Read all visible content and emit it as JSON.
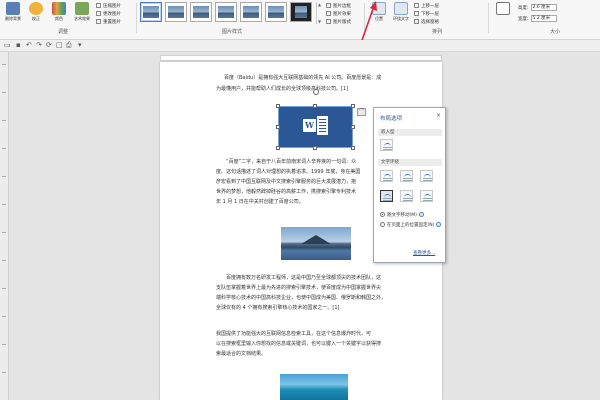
{
  "ribbon": {
    "tools": [
      {
        "label": "删除背景",
        "color": "#5b7fb4"
      },
      {
        "label": "校正",
        "color": "#f0b23b"
      },
      {
        "label": "颜色",
        "color": "#c84f4f"
      },
      {
        "label": "艺术效果",
        "color": "#7aa75a"
      }
    ],
    "small_commands": [
      "压缩图片",
      "更改图片",
      "重置图片"
    ],
    "adjust_group_label": "调整",
    "styles_group_label": "图片样式",
    "picture_commands": [
      "图片边框",
      "图片效果",
      "图片版式"
    ],
    "arrange_commands": [
      "位置",
      "环绕文字",
      "上移一层",
      "下移一层",
      "选择窗格"
    ],
    "arrange_group_label": "排列",
    "size_group_label": "大小",
    "size_fields": [
      {
        "label": "高度:",
        "value": "2.6 厘米"
      },
      {
        "label": "宽度:",
        "value": "5.2 厘米"
      }
    ]
  },
  "document": {
    "para1_line1": "百度（Baidu）是拥有强大互联网基础的领先 AI 公司。百度愿景是：成",
    "para1_line2": "为最懂用户，并能帮助人们成长的全球顶级高科技公司。[1]",
    "para2_lines": [
      "“百度”二字，来自于八百年前南宋词人辛弃疾的一句词：众",
      "度。这句话描述了词人对理想的执着追求。1999 年底，身在美国",
      "彦宏看到了中国互联网及中文搜索引擎服务的巨大发展潜力，抱",
      "世界的梦想，他毅然辞掉硅谷的高薪工作，携搜索引擎专利技术",
      "年 1 月 1 日在中关村创建了百度公司。"
    ],
    "para2_link": "辛弃疾",
    "para3_lines": [
      "百度拥有数万名研发工程师，这是中国乃至全球都顶尖的技术团队，这",
      "支队伍掌握着世界上最为先进的搜索引擎技术，使百度成为中国掌握世界尖",
      "端科学核心技术的中国高科技企业，也使中国成为美国、俄罗斯和韩国之外，",
      "全球仅有的 4 个拥有搜索引擎核心技术的国家之一。[1]"
    ],
    "para4_lines": [
      "我国提供了功能强大的互联网信息检索工具，在这个信息爆炸时代，可",
      "以在搜索框里输入你想找的信息或关键词，也可以键入一个关键字以获得搜",
      "索最适合的文档结果。"
    ]
  },
  "layout_panel": {
    "title": "布局选项",
    "close": "×",
    "inline_section": "嵌入型",
    "wrap_section": "文字环绕",
    "radio_move": "随文字移动(M)",
    "radio_fix": "在页面上的位置固定(N)",
    "see_more": "查看更多..."
  },
  "colors": {
    "accent": "#2b579a",
    "annotation": "#d42a3a"
  }
}
